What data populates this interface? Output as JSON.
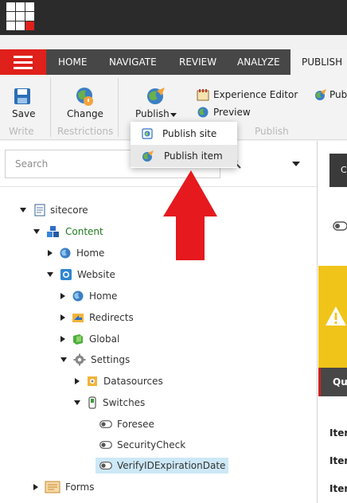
{
  "header": {
    "logo_icon": "sitecore-launchpad-grid-icon"
  },
  "nav": {
    "menu_icon": "hamburger-menu-icon",
    "tabs": [
      {
        "label": "HOME"
      },
      {
        "label": "NAVIGATE"
      },
      {
        "label": "REVIEW"
      },
      {
        "label": "ANALYZE"
      },
      {
        "label": "PUBLISH",
        "active": true
      }
    ]
  },
  "ribbon": {
    "save": {
      "label": "Save",
      "icon": "save-icon"
    },
    "change": {
      "label": "Change",
      "icon": "change-icon"
    },
    "publish": {
      "label": "Publish",
      "icon": "publish-icon"
    },
    "experience_editor": {
      "label": "Experience Editor",
      "icon": "experience-editor-icon"
    },
    "preview": {
      "label": "Preview",
      "icon": "preview-icon"
    },
    "publish_cut": {
      "label": "Pub"
    },
    "groups": {
      "write": "Write",
      "restrictions": "Restrictions",
      "publish": "Publish"
    }
  },
  "publish_menu": {
    "items": [
      {
        "label": "Publish site",
        "icon": "publish-site-icon"
      },
      {
        "label": "Publish item",
        "icon": "publish-item-icon",
        "highlighted": true
      }
    ]
  },
  "search": {
    "placeholder": "Search"
  },
  "tree": {
    "items": [
      {
        "label": "sitecore",
        "icon": "document-icon",
        "state": "expanded"
      },
      {
        "label": "Content",
        "icon": "content-cubes-icon",
        "state": "expanded",
        "color": "#1f7a1f"
      },
      {
        "label": "Home",
        "icon": "home-globe-icon",
        "state": "collapsed"
      },
      {
        "label": "Website",
        "icon": "website-icon",
        "state": "expanded"
      },
      {
        "label": "Home",
        "icon": "home-globe-icon",
        "state": "collapsed"
      },
      {
        "label": "Redirects",
        "icon": "redirects-icon",
        "state": "collapsed"
      },
      {
        "label": "Global",
        "icon": "global-icon",
        "state": "collapsed"
      },
      {
        "label": "Settings",
        "icon": "gear-icon",
        "state": "expanded"
      },
      {
        "label": "Datasources",
        "icon": "datasources-icon",
        "state": "collapsed"
      },
      {
        "label": "Switches",
        "icon": "switches-icon",
        "state": "expanded"
      },
      {
        "label": "Foresee",
        "icon": "toggle-switch-icon",
        "state": "leaf"
      },
      {
        "label": "SecurityCheck",
        "icon": "toggle-switch-icon",
        "state": "leaf"
      },
      {
        "label": "VerifyIDExpirationDate",
        "icon": "toggle-switch-icon",
        "state": "leaf",
        "selected": true
      },
      {
        "label": "Forms",
        "icon": "forms-icon",
        "state": "collapsed"
      }
    ]
  },
  "right_panel": {
    "tab_label": "C",
    "quick_label": "Qui",
    "rows": [
      "Iter",
      "Iter",
      "Iter"
    ],
    "warning_icon": "warning-icon",
    "toggle_icon": "toggle-switch-icon",
    "warning_color": "#f0c419"
  },
  "annotation": {
    "arrow_icon": "red-up-arrow-icon",
    "color": "#e5191e"
  }
}
